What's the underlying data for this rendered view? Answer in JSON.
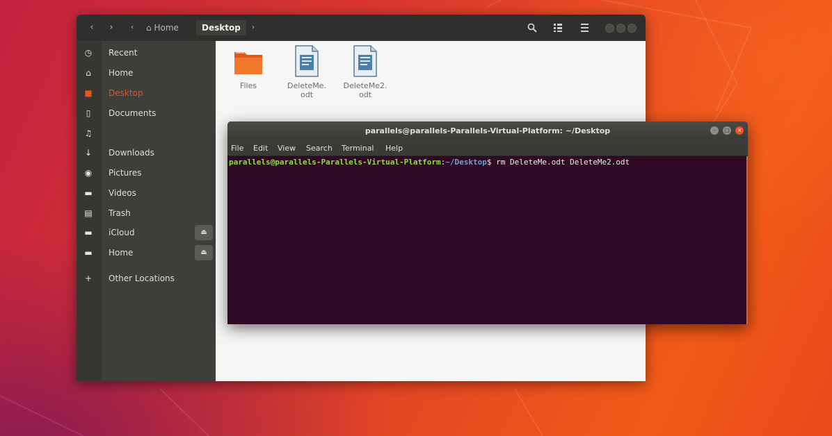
{
  "colors": {
    "accent": "#e95420",
    "terminal_bg": "#300a24",
    "prompt_user": "#8ae234",
    "prompt_path": "#729fcf"
  },
  "nautilus": {
    "header": {
      "back_icon": "chevron-left-icon",
      "forward_icon": "chevron-right-icon",
      "breadcrumbs": [
        {
          "label": "Home",
          "icon": "home-icon"
        },
        {
          "label": "Desktop",
          "active": true
        }
      ],
      "search_icon": "search-icon",
      "view_icon": "view-options-icon",
      "menu_icon": "hamburger-menu-icon"
    },
    "sidebar": {
      "items": [
        {
          "label": "Recent",
          "icon": "clock-icon"
        },
        {
          "label": "Home",
          "icon": "home-icon"
        },
        {
          "label": "Desktop",
          "icon": "folder-icon",
          "current": true
        },
        {
          "label": "Documents",
          "icon": "document-icon"
        },
        {
          "label": "",
          "icon": "music-icon"
        },
        {
          "label": "Downloads",
          "icon": "download-icon"
        },
        {
          "label": "Pictures",
          "icon": "camera-icon"
        },
        {
          "label": "Videos",
          "icon": "video-icon"
        },
        {
          "label": "Trash",
          "icon": "trash-icon"
        },
        {
          "label": "iCloud",
          "icon": "drive-icon",
          "eject": true
        },
        {
          "label": "Home",
          "icon": "drive-icon",
          "eject": true
        },
        {
          "label": "Other Locations",
          "icon": "plus-icon"
        }
      ]
    },
    "files": [
      {
        "label": "Files",
        "icon": "folder-icon"
      },
      {
        "label": "DeleteMe.\nodt",
        "icon": "odt-document-icon"
      },
      {
        "label": "DeleteMe2.\nodt",
        "icon": "odt-document-icon"
      }
    ]
  },
  "terminal": {
    "title": "parallels@parallels-Parallels-Virtual-Platform: ~/Desktop",
    "menu": [
      "File",
      "Edit",
      "View",
      "Search",
      "Terminal",
      "Help"
    ],
    "prompt_user": "parallels@parallels-Parallels-Virtual-Platform",
    "prompt_sep": ":",
    "prompt_path": "~/Desktop",
    "prompt_symbol": "$",
    "command": " rm DeleteMe.odt DeleteMe2.odt"
  }
}
